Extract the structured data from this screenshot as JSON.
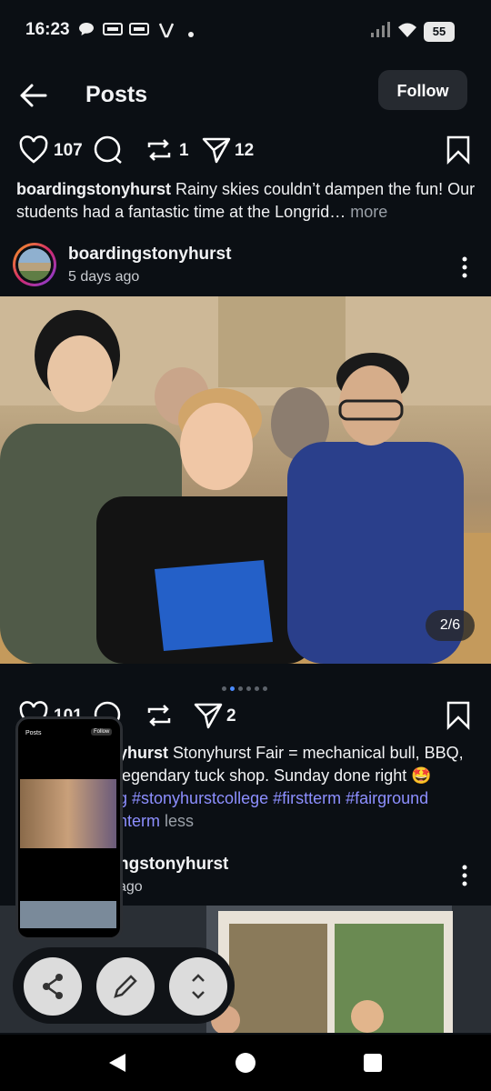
{
  "status_bar": {
    "time": "16:23",
    "battery": "55",
    "icons": [
      "chat-bubble-icon",
      "ok-notification-icon",
      "ok-notification-icon",
      "vpn-icon",
      "dot-icon",
      "signal-icon",
      "wifi-icon",
      "battery-icon"
    ]
  },
  "header": {
    "title": "Posts",
    "follow_label": "Follow"
  },
  "post1": {
    "likes": "107",
    "reposts": "1",
    "shares": "12",
    "caption_user": "boardingstonyhurst",
    "caption_text": " Rainy skies couldn’t dampen the fun! Our students had a fantastic time at the Longrid…",
    "more_label": " more"
  },
  "post2_author": {
    "username": "boardingstonyhurst",
    "date": "5 days ago",
    "carousel_position": "2/6"
  },
  "post2": {
    "likes": "101",
    "shares": "2",
    "caption_user_partial": "yhurst",
    "caption_line1_rest": " Stonyhurst Fair = mechanical bull, BBQ,",
    "caption_line2": "legendary tuck shop. Sunday done right 🤩",
    "tags_line": "g #stonyhurstcollege #firstterm #fairground",
    "tags_line2_tag": "nterm",
    "less_label": " less"
  },
  "post3_author": {
    "username_partial": "ngstonyhurst",
    "date_partial": "ago"
  },
  "thumbnail": {
    "title": "Posts",
    "follow": "Follow"
  },
  "colors": {
    "background": "#0b0f14",
    "hashtag": "#8d8fff",
    "active_dot": "#4a8bff"
  }
}
